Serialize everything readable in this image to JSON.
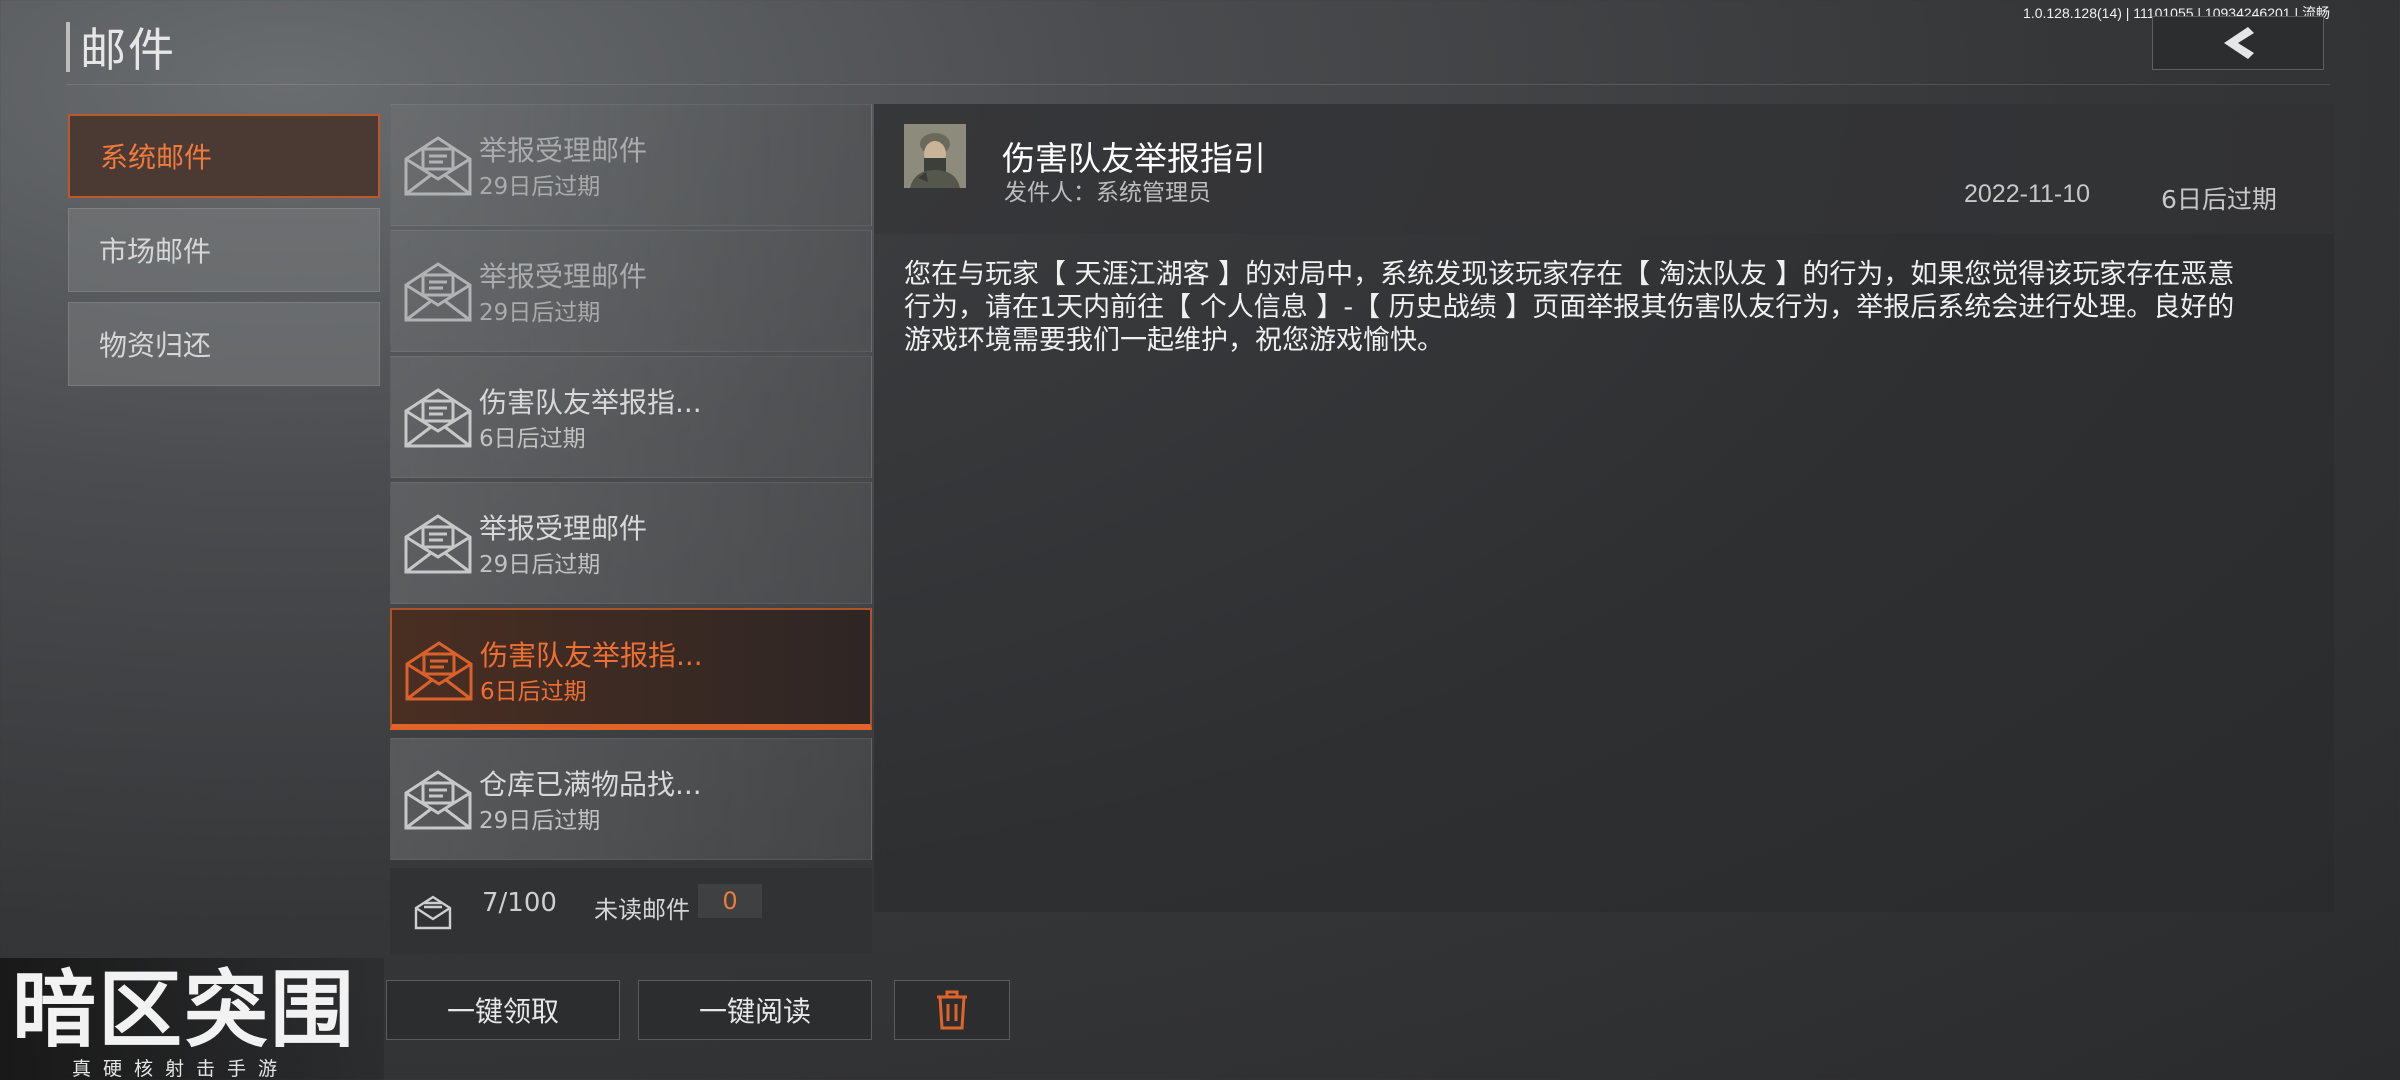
{
  "header": {
    "title": "邮件",
    "version": "1.0.128.128(14) | 11101055 | 10934246201 | 流畅",
    "back_icon": "chevron-left-icon"
  },
  "categories": [
    {
      "label": "系统邮件",
      "active": true
    },
    {
      "label": "市场邮件",
      "active": false
    },
    {
      "label": "物资归还",
      "active": false
    }
  ],
  "mail_list": [
    {
      "title": "举报受理邮件",
      "expire": "29日后过期",
      "state": "read"
    },
    {
      "title": "举报受理邮件",
      "expire": "29日后过期",
      "state": "read"
    },
    {
      "title": "伤害队友举报指...",
      "expire": "6日后过期",
      "state": "read"
    },
    {
      "title": "举报受理邮件",
      "expire": "29日后过期",
      "state": "unread"
    },
    {
      "title": "伤害队友举报指...",
      "expire": "6日后过期",
      "state": "selected"
    },
    {
      "title": "仓库已满物品找...",
      "expire": "29日后过期",
      "state": "unread"
    }
  ],
  "list_footer": {
    "mail_count": "7/100",
    "unread_label": "未读邮件",
    "unread_count": "0"
  },
  "detail": {
    "title": "伤害队友举报指引",
    "sender": "发件人：系统管理员",
    "date": "2022-11-10",
    "expire": "6日后过期",
    "body_lines": [
      "您在与玩家【 天涯江湖客 】的对局中，系统发现该玩家存在【 淘汰队友 】的行为，如果您觉得该玩家存在恶意",
      "行为，请在1天内前往【 个人信息 】-【 历史战绩 】页面举报其伤害队友行为，举报后系统会进行处理。良好的",
      "游戏环境需要我们一起维护，祝您游戏愉快。"
    ]
  },
  "actions": {
    "claim_all": "一键领取",
    "read_all": "一键阅读",
    "delete_icon": "trash-icon"
  },
  "logo": {
    "main": "暗区突围",
    "sub": "真硬核射击手游"
  },
  "colors": {
    "accent": "#e0642a",
    "accent_text": "#f07a3c"
  }
}
